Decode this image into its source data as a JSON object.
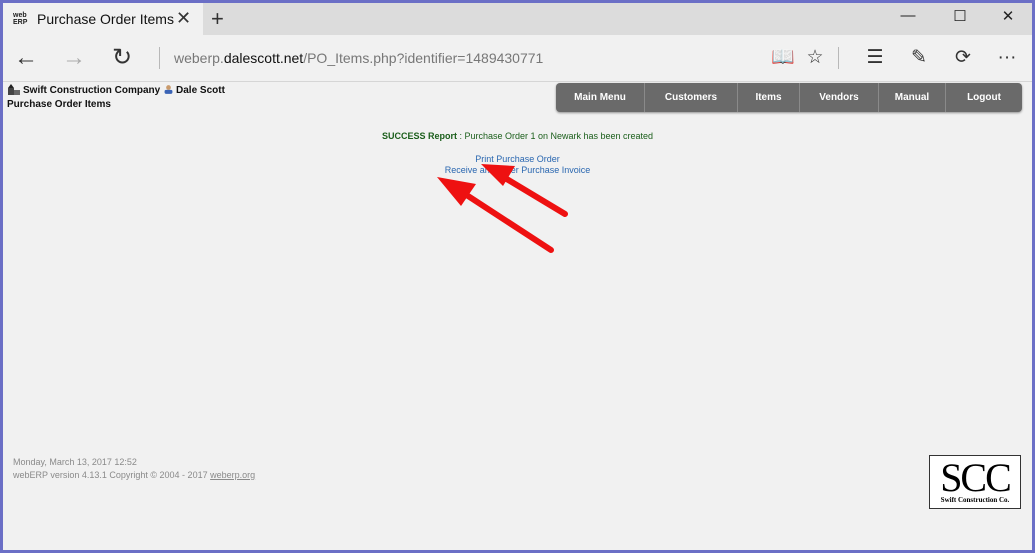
{
  "browser": {
    "tab_title": "Purchase Order Items",
    "favicon_text_top": "web",
    "favicon_text_bottom": "ERP",
    "close_glyph": "✕",
    "new_tab_glyph": "+",
    "window_buttons": {
      "minimize": "—",
      "maximize": "☐",
      "close": "✕"
    },
    "back_glyph": "←",
    "forward_glyph": "→",
    "refresh_glyph": "↻",
    "url_prefix": "weberp.",
    "url_host": "dalescott.net",
    "url_path": "/PO_Items.php?identifier=1489430771",
    "tools": {
      "reading_view": "📖",
      "favorite": "☆",
      "hub": "☰",
      "notes": "✎",
      "share": "⟳",
      "more": "···"
    }
  },
  "header": {
    "company": "Swift Construction Company",
    "user": "Dale Scott",
    "page_title": "Purchase Order Items"
  },
  "menu": {
    "items": [
      "Main Menu",
      "Customers",
      "Items",
      "Vendors",
      "Manual",
      "Logout"
    ]
  },
  "message": {
    "label": "SUCCESS Report",
    "text": " : Purchase Order 1 on Newark has been created"
  },
  "links": {
    "print": "Print Purchase Order",
    "receive": "Receive and Enter Purchase Invoice"
  },
  "footer": {
    "datetime": "Monday, March 13, 2017 12:52",
    "version": "webERP version 4.13.1 Copyright © 2004 - 2017 ",
    "site_link": "weberp.org"
  },
  "logo": {
    "main": "SCC",
    "sub": "Swift Construction Co."
  },
  "colors": {
    "accent_border": "#6b6fc6",
    "menu_bg": "#6a6a6a",
    "success_text": "#1a5e1a",
    "link_text": "#2a67b0",
    "arrow": "#ee1111"
  }
}
